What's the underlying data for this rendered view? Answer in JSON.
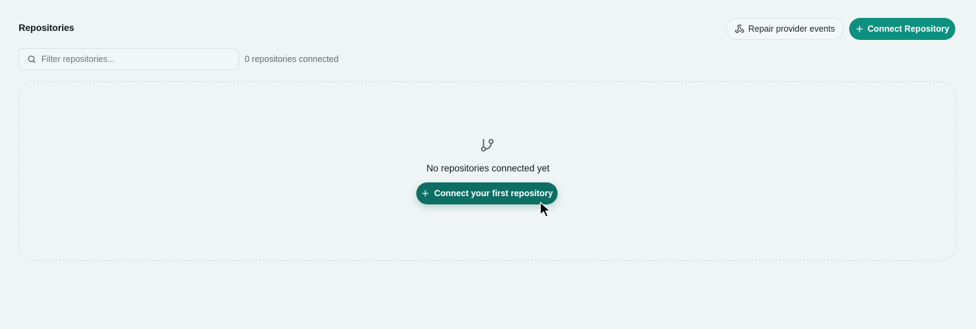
{
  "header": {
    "title": "Repositories",
    "repair_label": "Repair provider events",
    "connect_label": "Connect Repository"
  },
  "filter": {
    "placeholder": "Filter repositories...",
    "value": "",
    "count_text": "0 repositories connected"
  },
  "empty_state": {
    "message": "No repositories connected yet",
    "cta_label": "Connect your first repository",
    "icon": "git-branch-icon"
  },
  "colors": {
    "background": "#eff4f4",
    "primary": "#0e9080",
    "primary_dark": "#0d6e63"
  }
}
